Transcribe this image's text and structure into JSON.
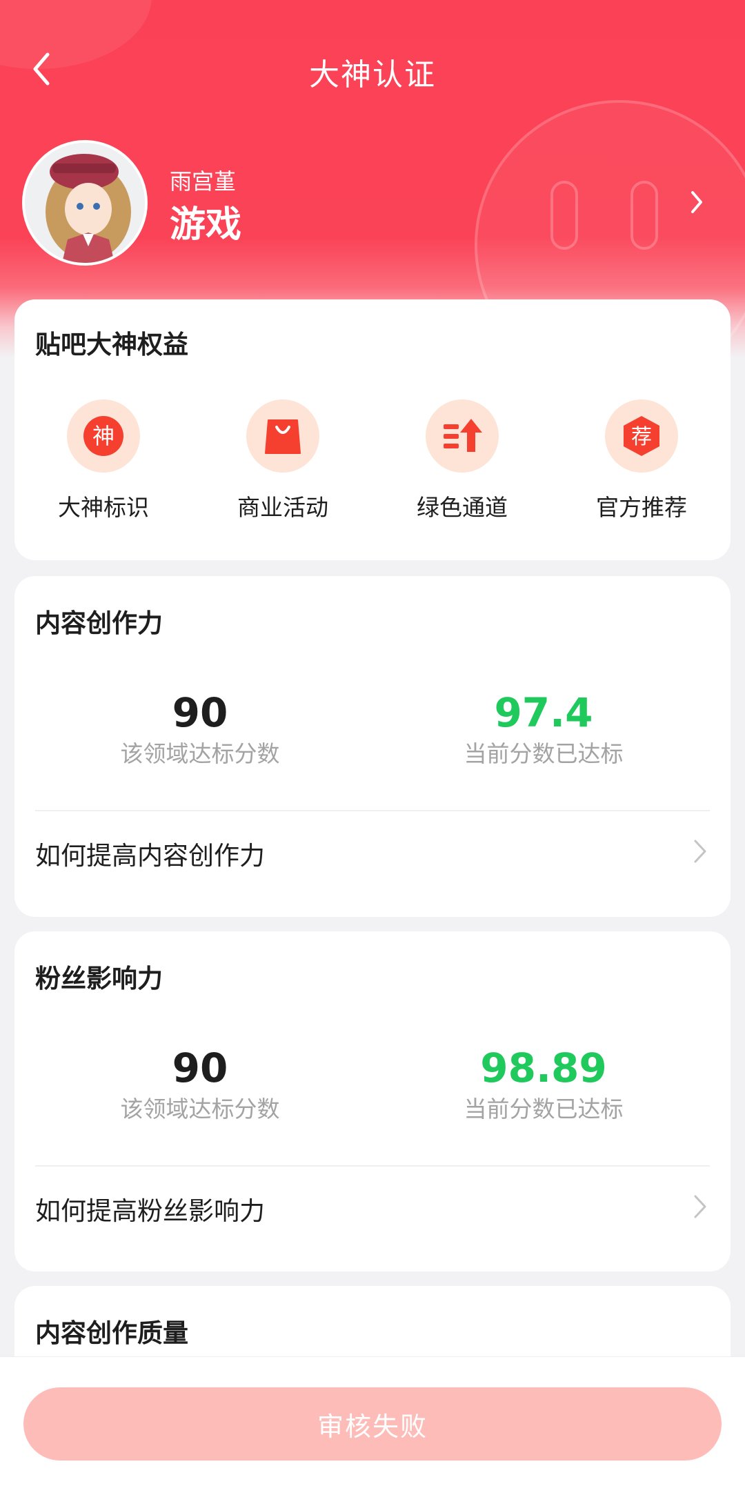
{
  "header": {
    "title": "大神认证",
    "user_name": "雨宫堇",
    "user_field": "游戏"
  },
  "benefits": {
    "title": "贴吧大神权益",
    "items": [
      {
        "label": "大神标识",
        "icon": "shen-badge-icon",
        "glyph": "神"
      },
      {
        "label": "商业活动",
        "icon": "shopping-bag-icon"
      },
      {
        "label": "绿色通道",
        "icon": "upload-arrow-icon"
      },
      {
        "label": "官方推荐",
        "icon": "recommend-badge-icon",
        "glyph": "荐"
      }
    ]
  },
  "creation": {
    "title": "内容创作力",
    "target_value": "90",
    "target_label": "该领域达标分数",
    "current_value": "97.4",
    "current_label": "当前分数已达标",
    "tip": "如何提高内容创作力"
  },
  "fans": {
    "title": "粉丝影响力",
    "target_value": "90",
    "target_label": "该领域达标分数",
    "current_value": "98.89",
    "current_label": "当前分数已达标",
    "tip": "如何提高粉丝影响力"
  },
  "quality": {
    "title": "内容创作质量"
  },
  "footer": {
    "button_label": "审核失败"
  },
  "colors": {
    "brand": "#fb4155",
    "success": "#1fc95c",
    "button_disabled": "#fdbcb8"
  }
}
